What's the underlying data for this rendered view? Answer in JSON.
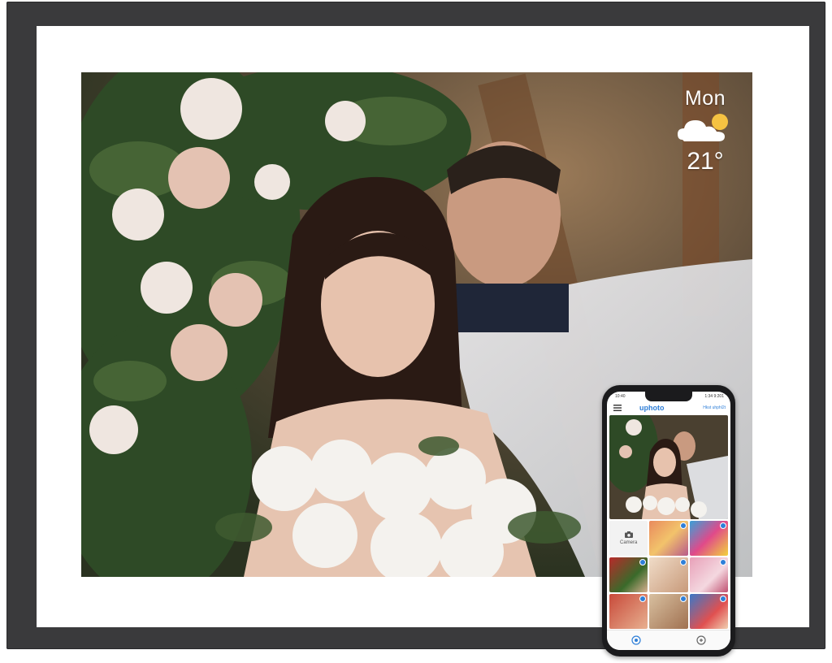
{
  "frame_display": {
    "weather": {
      "day": "Mon",
      "temperature": "21°",
      "condition_icon": "partly-cloudy-icon"
    }
  },
  "phone_app": {
    "brand": "uphoto",
    "brand_sub": "Hkst uhphl2t",
    "status_time": "10:40",
    "status_date": "1:34 9:201",
    "camera_label": "Camera",
    "tabs": [
      "home-icon",
      "settings-icon"
    ]
  },
  "colors": {
    "frame": "#3a3a3c",
    "accent": "#2f7fd8"
  }
}
